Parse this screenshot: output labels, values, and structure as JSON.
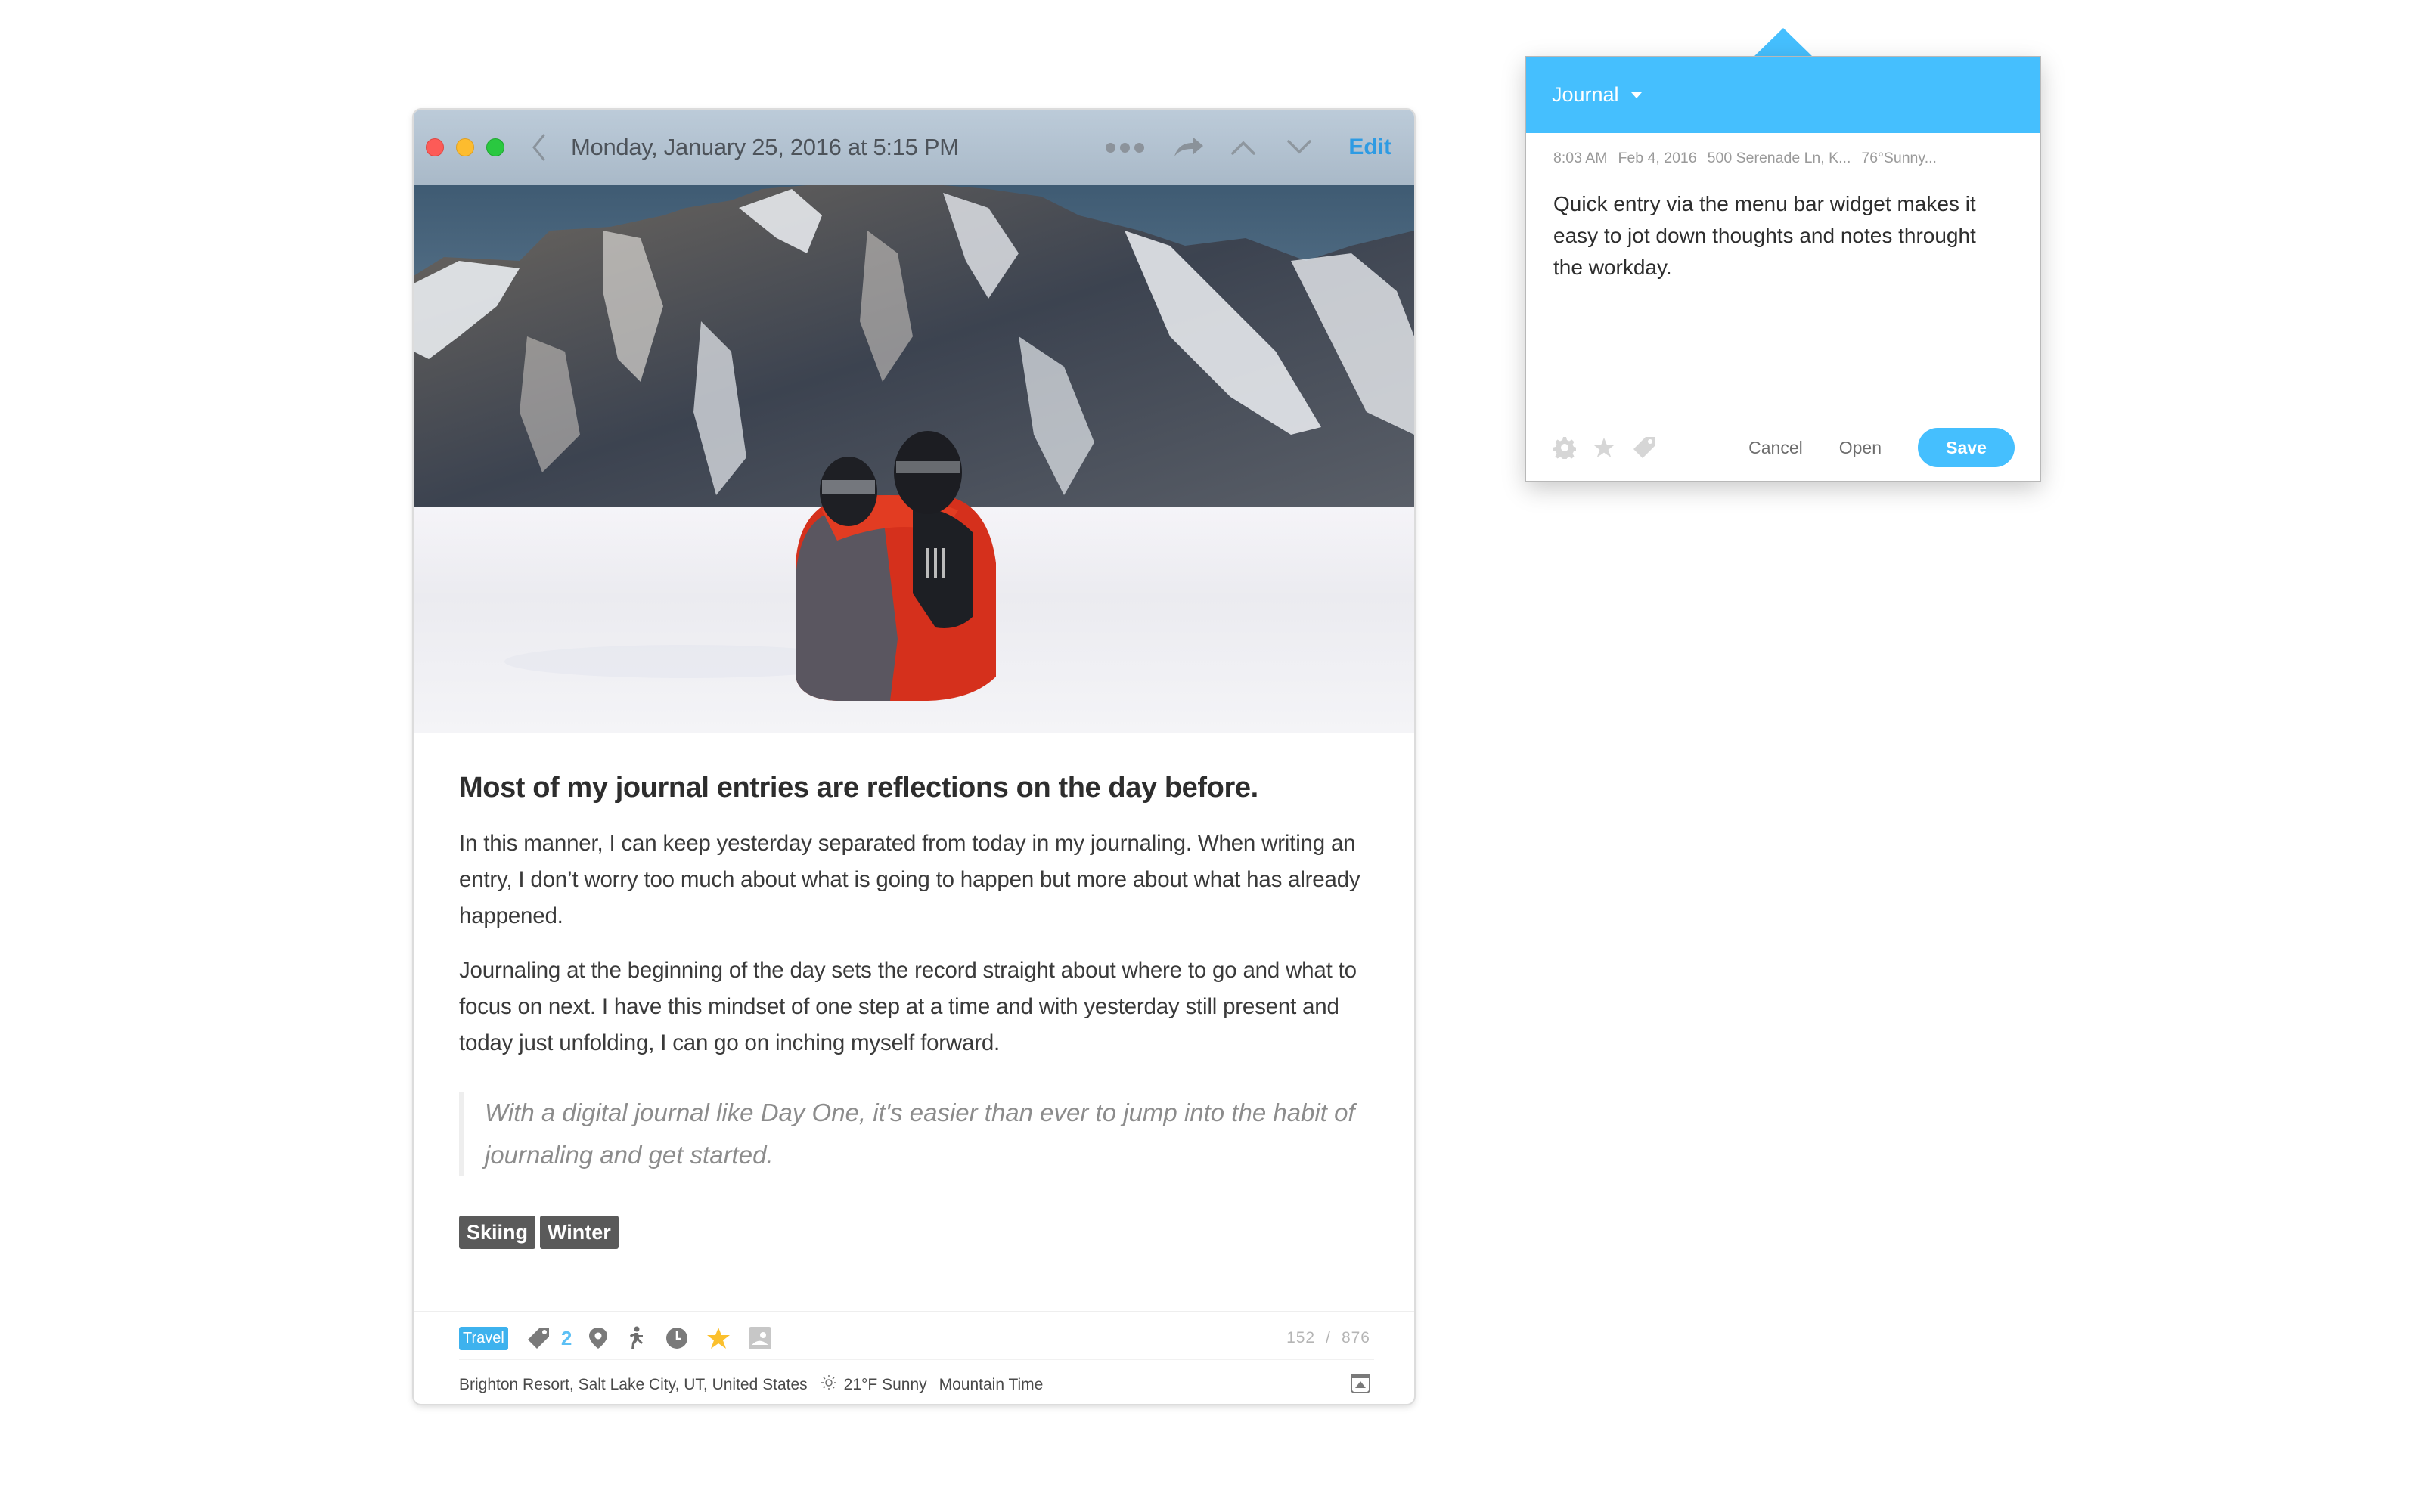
{
  "window": {
    "title": "Monday, January 25, 2016 at 5:15 PM",
    "edit_label": "Edit",
    "icons": [
      "chevron-left-icon",
      "more-icon",
      "share-icon",
      "chevron-up-icon",
      "chevron-down-icon"
    ]
  },
  "entry": {
    "photo_alt": "Couple sitting in snow facing snowy mountains",
    "heading": "Most of my journal entries are reflections on the day before.",
    "paragraphs": [
      "In this manner, I can keep yesterday separated from today in my journaling. When writing an entry, I don’t worry too much about what is going to happen but more about what has already happened.",
      "Journaling at the beginning of the day sets the record straight about where to go and what to focus on next. I have this mindset of one step at a time and with yesterday still present and today just unfolding, I can go on inching myself forward."
    ],
    "quote": "With a digital journal like Day One, it's easier than ever to jump into the habit of journaling and get started.",
    "tags": [
      "Skiing",
      "Winter"
    ]
  },
  "footer": {
    "journal_badge": "Travel",
    "tag_count": "2",
    "word_count": "152",
    "char_count": "876",
    "count_separator": "/",
    "location": "Brighton Resort, Salt Lake City, UT, United States",
    "weather": "21°F Sunny",
    "timezone": "Mountain Time",
    "starred": true,
    "colors": {
      "badge": "#3db2ee",
      "star": "#fbc02d"
    }
  },
  "popup": {
    "journal": "Journal",
    "meta": {
      "time": "8:03 AM",
      "date": "Feb 4, 2016",
      "location": "500 Serenade Ln, K...",
      "weather": "76°Sunny..."
    },
    "text": "Quick entry via the menu bar widget makes it easy to jot down thoughts and notes throught the workday.",
    "cancel_label": "Cancel",
    "open_label": "Open",
    "save_label": "Save",
    "accent_color": "#45bffe"
  }
}
